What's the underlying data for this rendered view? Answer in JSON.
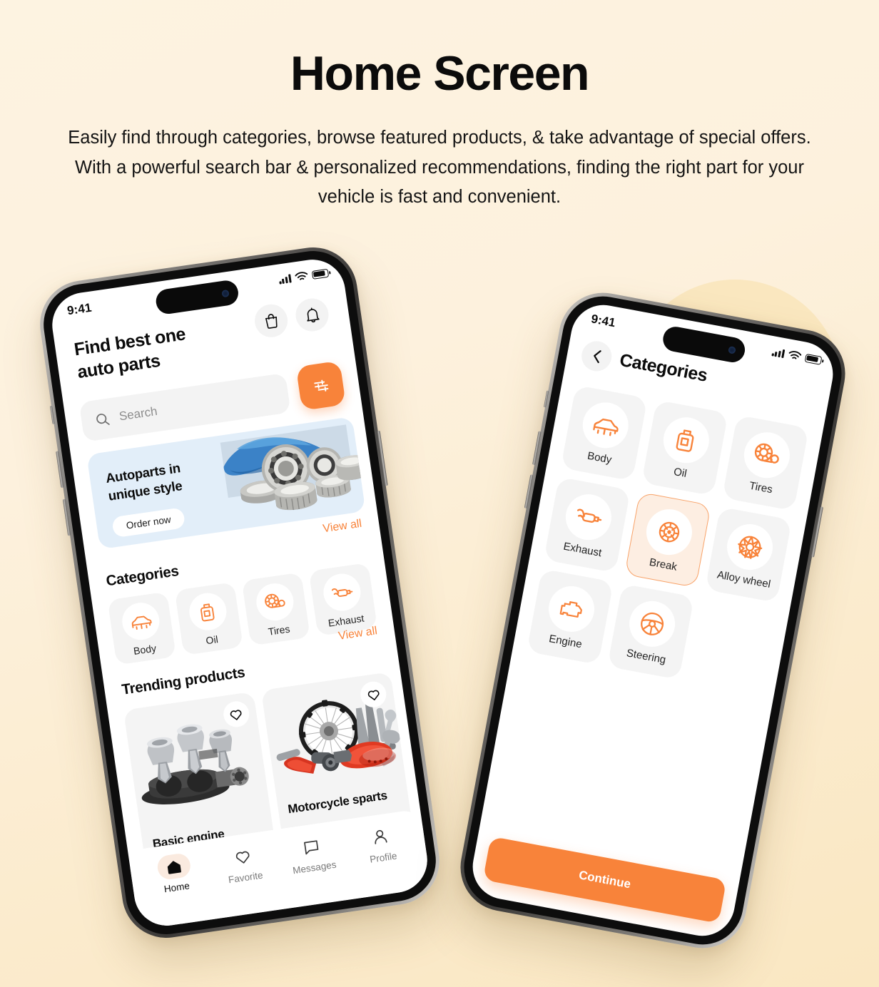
{
  "header": {
    "title": "Home Screen",
    "subtitle": "Easily find through categories, browse featured products, & take advantage of special offers. With a powerful search bar & personalized recommendations, finding the right part for your vehicle is fast and convenient."
  },
  "colors": {
    "accent": "#F8833A",
    "background_top": "#FDF3E1",
    "background_bottom": "#FAE7C2",
    "banner_blue": "#E2EEF9",
    "card_gray": "#F4F4F4",
    "selected_tile": "#FDEEE2"
  },
  "phone1": {
    "status": {
      "time": "9:41",
      "signal_icon": "cellular-bars-icon",
      "wifi_icon": "wifi-icon",
      "battery_icon": "battery-icon"
    },
    "heading": "Find best one\nauto parts",
    "bag_icon": "shopping-bag-icon",
    "bell_icon": "bell-icon",
    "search": {
      "placeholder": "Search",
      "icon": "search-icon"
    },
    "filter_icon": "filter-sliders-icon",
    "banner": {
      "title": "Autoparts in\nunique style",
      "cta": "Order now",
      "image": "bearings-image"
    },
    "categories_view_all": "View all",
    "categories_title": "Categories",
    "categories": [
      {
        "label": "Body",
        "icon": "car-body-icon"
      },
      {
        "label": "Oil",
        "icon": "oil-bottle-icon"
      },
      {
        "label": "Tires",
        "icon": "tire-gauge-icon"
      },
      {
        "label": "Exhaust",
        "icon": "exhaust-muffler-icon"
      }
    ],
    "trending_view_all": "View all",
    "trending_title": "Trending products",
    "products": [
      {
        "name": "Basic engine",
        "favorite_icon": "heart-icon",
        "image": "engine-pistons-image"
      },
      {
        "name": "Motorcycle sparts",
        "favorite_icon": "heart-icon",
        "image": "motorcycle-parts-image"
      }
    ],
    "tabs": [
      {
        "label": "Home",
        "icon": "home-icon",
        "active": true
      },
      {
        "label": "Favorite",
        "icon": "heart-icon",
        "active": false
      },
      {
        "label": "Messages",
        "icon": "chat-bubble-icon",
        "active": false
      },
      {
        "label": "Profile",
        "icon": "person-icon",
        "active": false
      }
    ]
  },
  "phone2": {
    "status": {
      "time": "9:41",
      "signal_icon": "cellular-bars-icon",
      "wifi_icon": "wifi-icon",
      "battery_icon": "battery-icon"
    },
    "back_icon": "chevron-left-icon",
    "title": "Categories",
    "categories": [
      {
        "label": "Body",
        "icon": "car-body-icon",
        "selected": false
      },
      {
        "label": "Oil",
        "icon": "oil-bottle-icon",
        "selected": false
      },
      {
        "label": "Tires",
        "icon": "tire-gauge-icon",
        "selected": false
      },
      {
        "label": "Exhaust",
        "icon": "exhaust-muffler-icon",
        "selected": false
      },
      {
        "label": "Break",
        "icon": "brake-disc-icon",
        "selected": true
      },
      {
        "label": "Alloy wheel",
        "icon": "alloy-wheel-icon",
        "selected": false
      },
      {
        "label": "Engine",
        "icon": "engine-check-icon",
        "selected": false
      },
      {
        "label": "Steering",
        "icon": "steering-wheel-icon",
        "selected": false
      }
    ],
    "continue_label": "Continue"
  }
}
